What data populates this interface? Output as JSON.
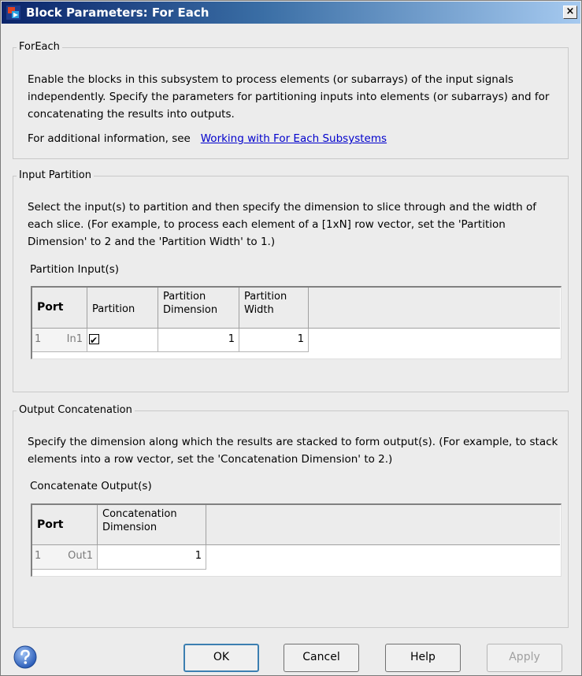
{
  "window": {
    "title": "Block Parameters: For Each",
    "close_label": "×"
  },
  "foreach": {
    "legend": "ForEach",
    "description": "Enable the blocks in this subsystem to process elements (or subarrays) of the input signals independently. Specify the parameters for partitioning inputs into elements (or subarrays) and for concatenating the results into outputs.",
    "info_prefix": "For additional information, see",
    "info_link": "Working with For Each Subsystems"
  },
  "input_partition": {
    "legend": "Input Partition",
    "description": "Select the input(s) to partition and then specify the dimension to slice through and the width of each slice. (For example, to process each element of a [1xN] row vector, set the 'Partition Dimension' to 2 and the 'Partition Width' to 1.)",
    "table_label": "Partition Input(s)",
    "headers": {
      "port": "Port",
      "partition": "Partition",
      "partition_dimension": "Partition Dimension",
      "partition_width": "Partition Width"
    },
    "rows": [
      {
        "index": "1",
        "port": "In1",
        "partition_checked": true,
        "partition_mark": "✔",
        "partition_dimension": "1",
        "partition_width": "1"
      }
    ]
  },
  "output_concatenation": {
    "legend": "Output Concatenation",
    "description": "Specify the dimension along which the results are stacked to form output(s). (For example, to stack elements into a row vector, set the 'Concatenation Dimension' to 2.)",
    "table_label": "Concatenate Output(s)",
    "headers": {
      "port": "Port",
      "concatenation_dimension": "Concatenation Dimension"
    },
    "rows": [
      {
        "index": "1",
        "port": "Out1",
        "concatenation_dimension": "1"
      }
    ]
  },
  "buttons": {
    "ok": "OK",
    "cancel": "Cancel",
    "help": "Help",
    "apply": "Apply",
    "apply_enabled": false
  },
  "icons": {
    "title_icon": "simulink-block-icon",
    "help_icon": "question-icon"
  },
  "colors": {
    "title_bar_start": "#0a246a",
    "title_bar_end": "#a6caf0",
    "dialog_background": "#ececec",
    "link": "#0000cc",
    "help_icon": "#3a6fc4"
  }
}
